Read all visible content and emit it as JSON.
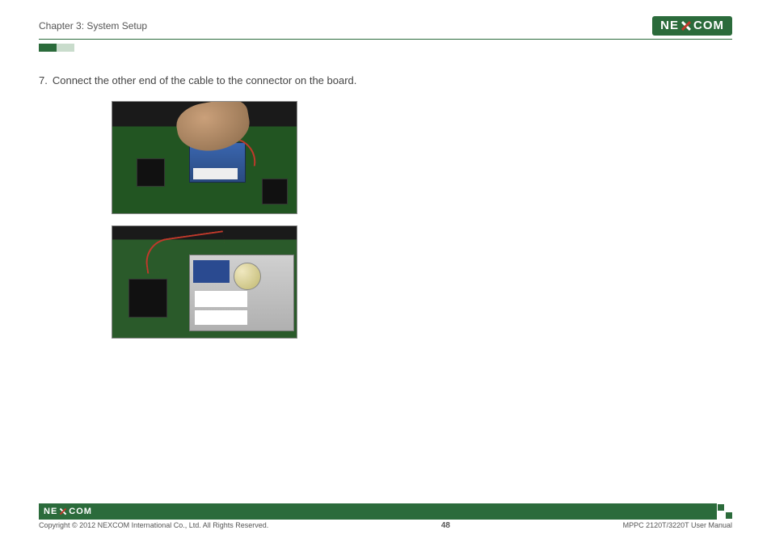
{
  "header": {
    "chapter": "Chapter 3: System Setup",
    "brand_left": "NE",
    "brand_right": "COM"
  },
  "content": {
    "step_number": "7.",
    "step_text": "Connect the other end of the cable to the connector on the board.",
    "image1_alt": "Hand connecting cable to motherboard connector near blue module",
    "image2_alt": "Close-up of motherboard with cable connected, coin cell battery and labels visible"
  },
  "footer": {
    "brand_left": "NE",
    "brand_right": "COM",
    "copyright": "Copyright © 2012 NEXCOM International Co., Ltd. All Rights Reserved.",
    "page_number": "48",
    "manual": "MPPC 2120T/3220T User Manual"
  }
}
